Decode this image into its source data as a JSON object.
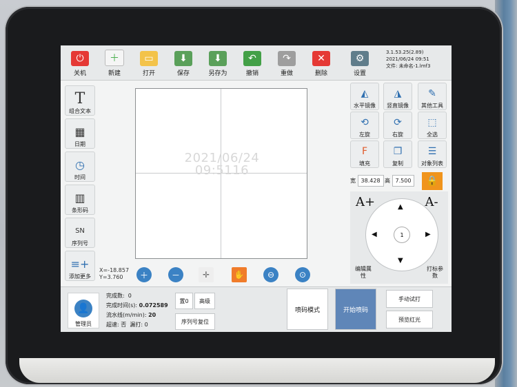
{
  "toolbar": {
    "items": [
      {
        "label": "关机",
        "icon": "power-icon",
        "color": "#e53935"
      },
      {
        "label": "新建",
        "icon": "new-file-icon",
        "color": "#4caf50"
      },
      {
        "label": "打开",
        "icon": "folder-icon",
        "color": "#f3c34a"
      },
      {
        "label": "保存",
        "icon": "save-icon",
        "color": "#5aa05a"
      },
      {
        "label": "另存为",
        "icon": "save-as-icon",
        "color": "#5aa05a"
      },
      {
        "label": "撤销",
        "icon": "undo-icon",
        "color": "#43a047"
      },
      {
        "label": "重做",
        "icon": "redo-icon",
        "color": "#9e9e9e"
      },
      {
        "label": "删除",
        "icon": "delete-icon",
        "color": "#e53935"
      },
      {
        "label": "设置",
        "icon": "settings-icon",
        "color": "#607d8b"
      }
    ],
    "version": "3.1.53.25(2.89)",
    "datetime": "2021/06/24 09:51",
    "file_label": "文件: 未命名-1.lmf3"
  },
  "left_tools": [
    {
      "label": "组合文本",
      "icon": "text-icon",
      "glyph": "T"
    },
    {
      "label": "日期",
      "icon": "calendar-icon",
      "glyph": "📅"
    },
    {
      "label": "时间",
      "icon": "clock-icon",
      "glyph": "◷"
    },
    {
      "label": "条形码",
      "icon": "barcode-icon",
      "glyph": "▥"
    },
    {
      "label": "序列号",
      "icon": "serial-icon",
      "glyph": "SN"
    },
    {
      "label": "添加更多",
      "icon": "add-more-icon",
      "glyph": "≡+"
    }
  ],
  "canvas": {
    "text_line1": "2021/06/24",
    "text_line2": "09:5116",
    "coord_x": "X=-18.857",
    "coord_y": "Y=3.760"
  },
  "right_tools": [
    {
      "label": "水平镜像",
      "icon": "mirror-horizontal-icon"
    },
    {
      "label": "竖直镜像",
      "icon": "mirror-vertical-icon"
    },
    {
      "label": "其他工具",
      "icon": "tools-icon"
    },
    {
      "label": "左旋",
      "icon": "rotate-left-icon"
    },
    {
      "label": "右旋",
      "icon": "rotate-right-icon"
    },
    {
      "label": "全选",
      "icon": "select-all-icon"
    },
    {
      "label": "填充",
      "icon": "fill-icon"
    },
    {
      "label": "复制",
      "icon": "copy-icon"
    },
    {
      "label": "对象列表",
      "icon": "object-list-icon"
    }
  ],
  "dimensions": {
    "width_label": "宽",
    "width_value": "38.428",
    "height_label": "高",
    "height_value": "7.500"
  },
  "dpad": {
    "center_label": "1",
    "font_larger": "A+",
    "font_smaller": "A-",
    "edit_props": "编辑属性",
    "print_params": "打标参数"
  },
  "bottom": {
    "admin_label": "管理员",
    "done_count_label": "完成数:",
    "done_count_value": "0",
    "done_time_label": "完成时间(s):",
    "done_time_value": "0.072589",
    "line_speed_label": "流水线(m/min):",
    "line_speed_value": "20",
    "overspeed_label": "超速: 否",
    "missed_label": "漏打: 0",
    "reset0_label": "置0",
    "advanced_label": "高级",
    "serial_reset_label": "序列号复位",
    "print_mode_label": "喷码模式",
    "start_print_label": "开始喷码",
    "manual_print_label": "手动试打",
    "preview_red_label": "预览红光"
  }
}
